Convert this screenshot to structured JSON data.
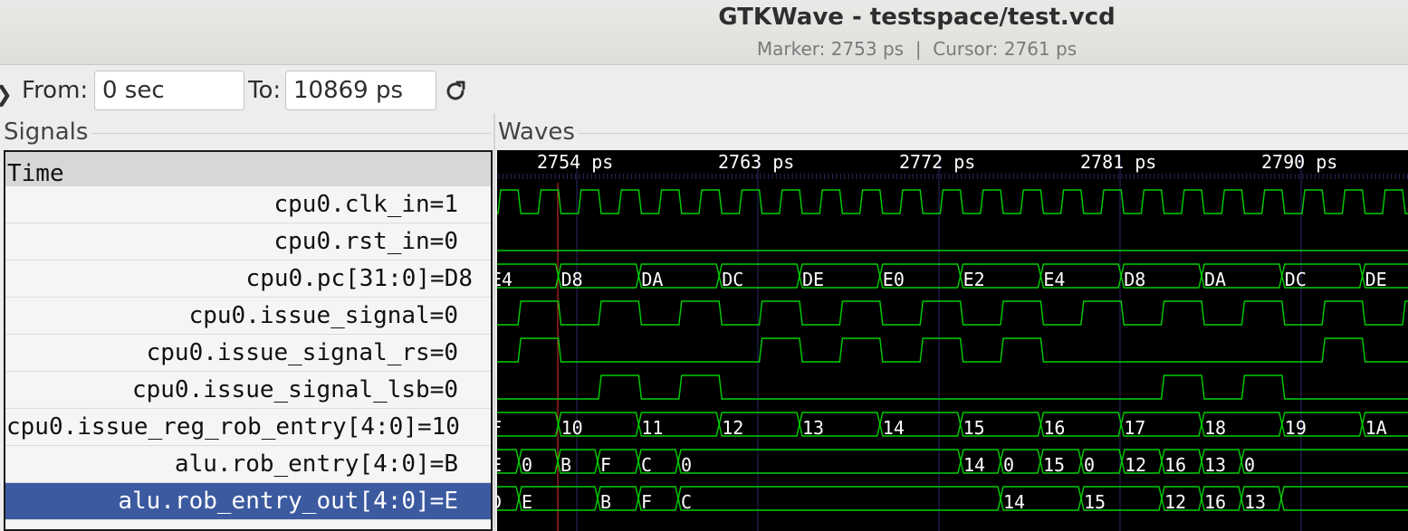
{
  "window": {
    "title": "GTKWave - testspace/test.vcd",
    "subtitle": "Marker: 2753 ps  |  Cursor: 2761 ps"
  },
  "toolbar": {
    "from_label": "From:",
    "from_value": "0 sec",
    "to_label": "To:",
    "to_value": "10869 ps"
  },
  "panes": {
    "signals_title": "Signals",
    "waves_title": "Waves"
  },
  "signals": {
    "time_header": "Time",
    "rows": [
      "cpu0.clk_in=1",
      "cpu0.rst_in=0",
      "cpu0.pc[31:0]=D8",
      "cpu0.issue_signal=0",
      "cpu0.issue_signal_rs=0",
      "cpu0.issue_signal_lsb=0",
      "cpu0.issue_reg_rob_entry[4:0]=10",
      "alu.rob_entry[4:0]=B",
      "alu.rob_entry_out[4:0]=E"
    ]
  },
  "timeline": {
    "tick_labels": [
      "2754 ps",
      "2763 ps",
      "2772 ps",
      "2781 ps",
      "2790 ps"
    ]
  },
  "waveforms": {
    "pc_values": [
      "E4",
      "D8",
      "DA",
      "DC",
      "DE",
      "E0",
      "E2",
      "E4",
      "D8",
      "DA",
      "DC",
      "DE"
    ],
    "rob_entry_values": [
      "F",
      "10",
      "11",
      "12",
      "13",
      "14",
      "15",
      "16",
      "17",
      "18",
      "19",
      "1A"
    ],
    "alu_rob_entry_labels": [
      "E",
      "0",
      "B",
      "F",
      "C",
      "0",
      "14",
      "0",
      "15",
      "0",
      "12",
      "16",
      "13",
      "0"
    ],
    "alu_rob_entry_out_labels": [
      "D",
      "E",
      "B",
      "F",
      "C",
      "14",
      "15",
      "12",
      "16",
      "13"
    ]
  },
  "colors": {
    "wave": "#00d000",
    "grid": "#2a2a66",
    "marker": "#e03030",
    "selection": "#3c5aa0"
  },
  "icons": {
    "expander": "chevron-right-icon",
    "refresh": "refresh-icon"
  }
}
